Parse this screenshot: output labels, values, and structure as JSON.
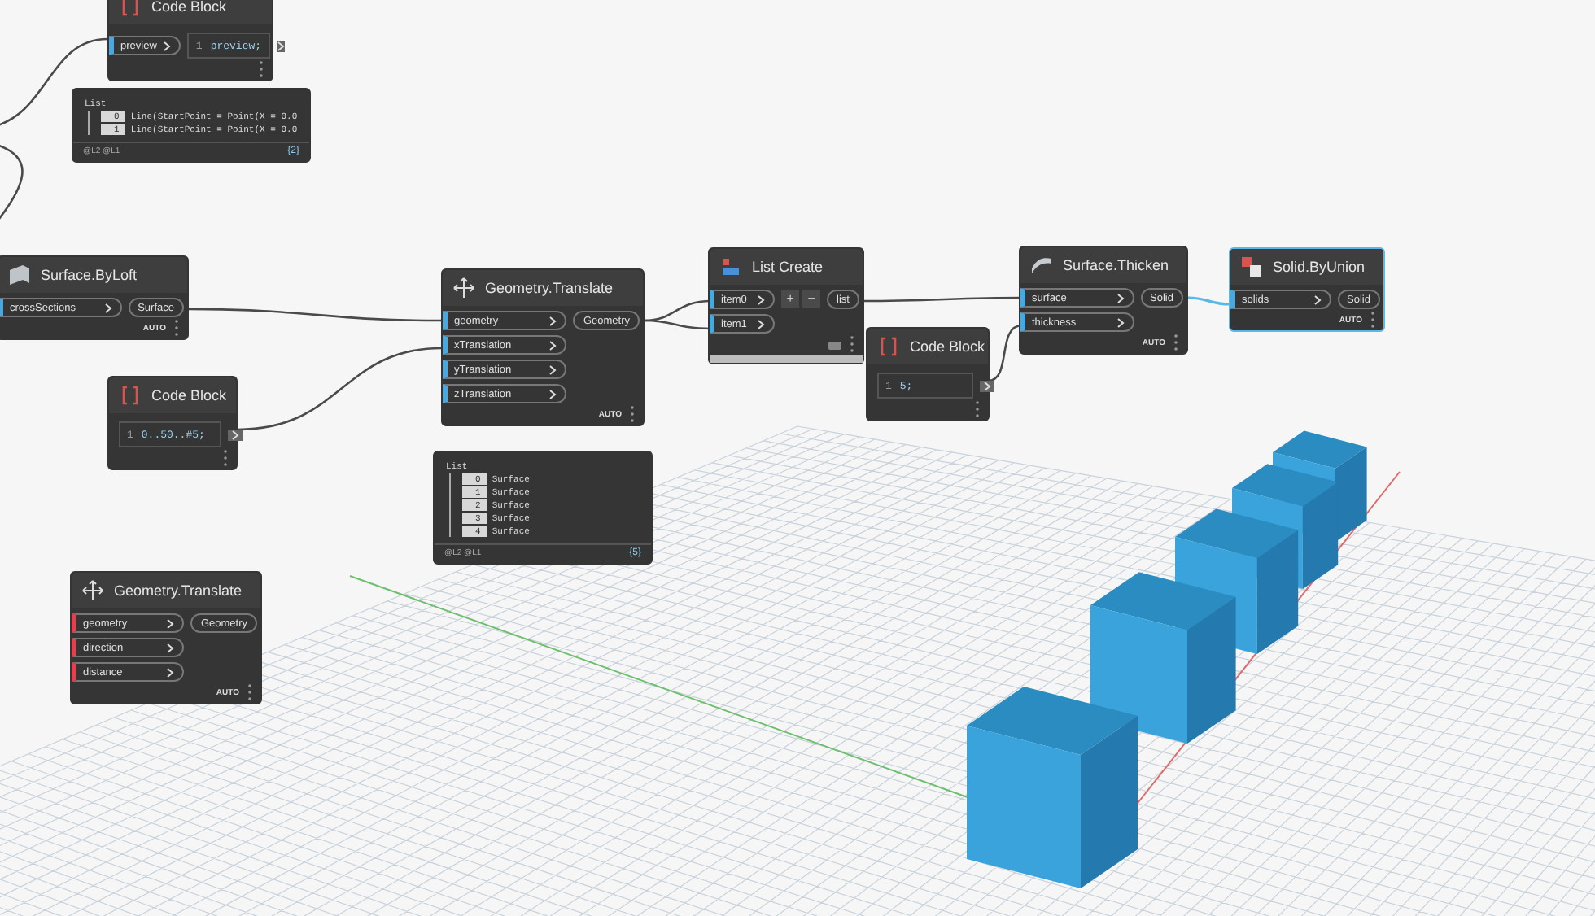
{
  "nodes": [
    {
      "kind": "code",
      "title": "Code Block",
      "selected": false,
      "inputs": [
        {
          "label": "preview",
          "warning": false
        }
      ],
      "lines": [
        {
          "number": "1",
          "code": "preview;"
        }
      ]
    },
    {
      "kind": "preview",
      "header": "List",
      "items": [
        {
          "index": "0",
          "value": "Line(StartPoint = Point(X = 0.0"
        },
        {
          "index": "1",
          "value": "Line(StartPoint = Point(X = 0.0"
        }
      ],
      "levels": "@L2 @L1",
      "count": "{2}"
    },
    {
      "kind": "function",
      "title": "Surface.ByLoft",
      "selected": false,
      "inputs": [
        {
          "label": "crossSections",
          "warning": false
        }
      ],
      "outputs": [
        "Surface"
      ],
      "lacing": "AUTO"
    },
    {
      "kind": "function",
      "title": "Geometry.Translate",
      "selected": false,
      "inputs": [
        {
          "label": "geometry",
          "warning": false
        },
        {
          "label": "xTranslation",
          "warning": false
        },
        {
          "label": "yTranslation",
          "warning": false
        },
        {
          "label": "zTranslation",
          "warning": false
        }
      ],
      "outputs": [
        "Geometry"
      ],
      "lacing": "AUTO"
    },
    {
      "kind": "list",
      "title": "List Create",
      "selected": false,
      "inputs": [
        {
          "label": "item0",
          "warning": false
        },
        {
          "label": "item1",
          "warning": false
        }
      ],
      "buttons": [
        "+",
        "−"
      ],
      "outputs": [
        "list"
      ]
    },
    {
      "kind": "function",
      "title": "Surface.Thicken",
      "selected": false,
      "inputs": [
        {
          "label": "surface",
          "warning": false
        },
        {
          "label": "thickness",
          "warning": false
        }
      ],
      "outputs": [
        "Solid"
      ],
      "lacing": "AUTO"
    },
    {
      "kind": "function",
      "title": "Solid.ByUnion",
      "selected": true,
      "inputs": [
        {
          "label": "solids",
          "warning": false
        }
      ],
      "outputs": [
        "Solid"
      ],
      "lacing": "AUTO"
    },
    {
      "kind": "code",
      "title": "Code Block",
      "selected": false,
      "lines": [
        {
          "number": "1",
          "code": "5;"
        }
      ]
    },
    {
      "kind": "code",
      "title": "Code Block",
      "selected": false,
      "lines": [
        {
          "number": "1",
          "code": "0..50..#5;"
        }
      ]
    },
    {
      "kind": "preview",
      "header": "List",
      "items": [
        {
          "index": "0",
          "value": "Surface"
        },
        {
          "index": "1",
          "value": "Surface"
        },
        {
          "index": "2",
          "value": "Surface"
        },
        {
          "index": "3",
          "value": "Surface"
        },
        {
          "index": "4",
          "value": "Surface"
        }
      ],
      "levels": "@L2 @L1",
      "count": "{5}"
    },
    {
      "kind": "function",
      "title": "Geometry.Translate",
      "selected": false,
      "inputs": [
        {
          "label": "geometry",
          "warning": true
        },
        {
          "label": "direction",
          "warning": true
        },
        {
          "label": "distance",
          "warning": true
        }
      ],
      "outputs": [
        "Geometry"
      ],
      "lacing": "AUTO"
    }
  ]
}
